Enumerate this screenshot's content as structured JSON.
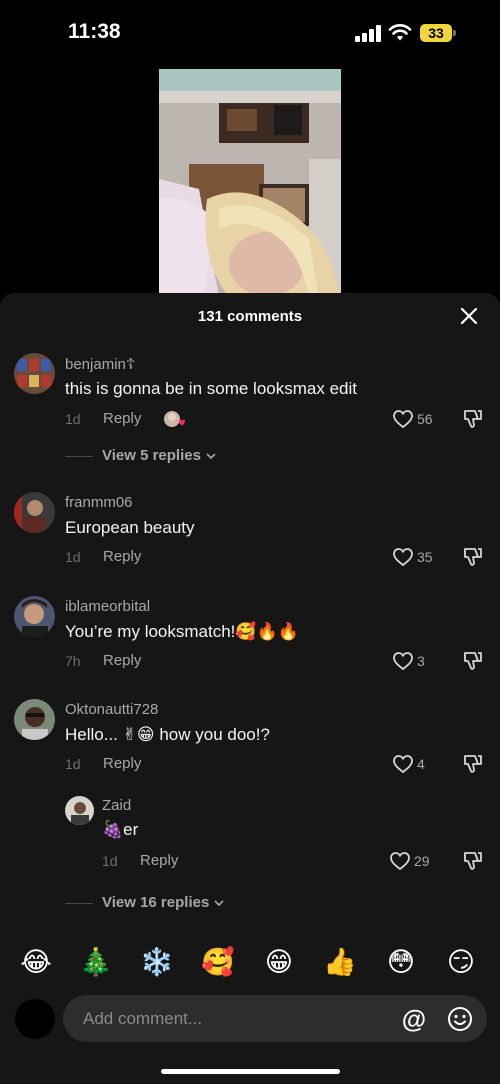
{
  "status": {
    "time": "11:38",
    "battery_level": "33",
    "icons": [
      "signal-icon",
      "wifi-icon",
      "battery-icon"
    ]
  },
  "sheet": {
    "title": "131 comments"
  },
  "comments": [
    {
      "username": "benjamin☦",
      "text": "this is gonna be in some looksmax edit",
      "date": "1d",
      "reply_label": "Reply",
      "likes": "56",
      "view_replies": "View 5 replies"
    },
    {
      "username": "franmm06",
      "text": "European beauty",
      "date": "1d",
      "reply_label": "Reply",
      "likes": "35"
    },
    {
      "username": "iblameorbital",
      "text": "You’re my looksmatch!",
      "emojis": "🥰🔥🔥",
      "date": "7h",
      "reply_label": "Reply",
      "likes": "3"
    },
    {
      "username": "Oktonautti728",
      "text_before": "Hello... ",
      "emojis": "✌😁",
      "text_after": " how you doo!?",
      "date": "1d",
      "reply_label": "Reply",
      "likes": "4",
      "view_replies": "View 16 replies",
      "reply": {
        "username": "Zaid",
        "emoji": "🍇",
        "text": "er",
        "date": "1d",
        "reply_label": "Reply",
        "likes": "29"
      }
    }
  ],
  "emoji_bar": [
    "😂",
    "🎄",
    "❄️",
    "🥰",
    "😁",
    "👍",
    "😳",
    "😏"
  ],
  "composer": {
    "placeholder": "Add comment...",
    "at_symbol": "@"
  },
  "colors": {
    "sheet_bg": "#161616",
    "input_bg": "#2d2d2d",
    "muted_text": "#a8a8a8",
    "battery": "#f2d43c"
  }
}
